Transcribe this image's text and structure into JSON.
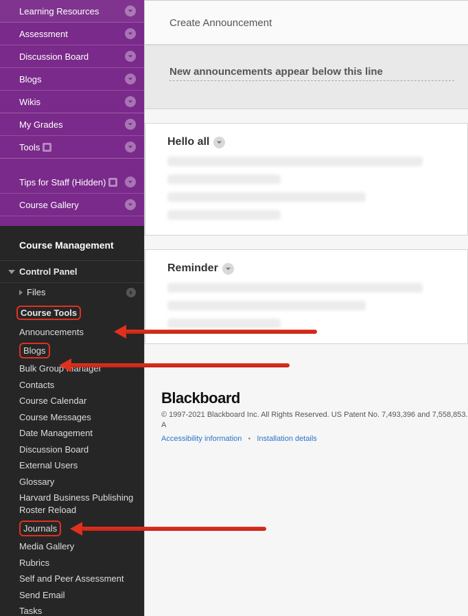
{
  "sidebar": {
    "purple_menu": [
      {
        "label": "Learning Resources",
        "badge": false
      },
      {
        "label": "Assessment",
        "badge": false
      },
      {
        "label": "Discussion Board",
        "badge": false
      },
      {
        "label": "Blogs",
        "badge": false
      },
      {
        "label": "Wikis",
        "badge": false
      }
    ],
    "purple_menu2": [
      {
        "label": "My Grades",
        "badge": false
      },
      {
        "label": "Tools",
        "badge": true
      }
    ],
    "purple_menu3": [
      {
        "label": "Tips for Staff (Hidden)",
        "badge": true
      },
      {
        "label": "Course Gallery",
        "badge": false
      }
    ],
    "mgmt_heading": "Course Management",
    "control_panel": "Control Panel",
    "files_row": "Files",
    "course_tools": "Course Tools",
    "tools": [
      "Announcements",
      "Blogs",
      "Bulk Group Manager",
      "Contacts",
      "Course Calendar",
      "Course Messages",
      "Date Management",
      "Discussion Board",
      "External Users",
      "Glossary",
      "Harvard Business Publishing Roster Reload",
      "Journals",
      "Media Gallery",
      "Rubrics",
      "Self and Peer Assessment",
      "Send Email",
      "Tasks"
    ]
  },
  "main": {
    "create_label": "Create Announcement",
    "notice": "New announcements appear below this line",
    "announcements": [
      {
        "title": "Hello all"
      },
      {
        "title": "Reminder"
      }
    ]
  },
  "footer": {
    "brand": "Blackboard",
    "copyright": "© 1997-2021 Blackboard Inc. All Rights Reserved. US Patent No. 7,493,396 and 7,558,853. A",
    "link1": "Accessibility information",
    "link2": "Installation details"
  }
}
